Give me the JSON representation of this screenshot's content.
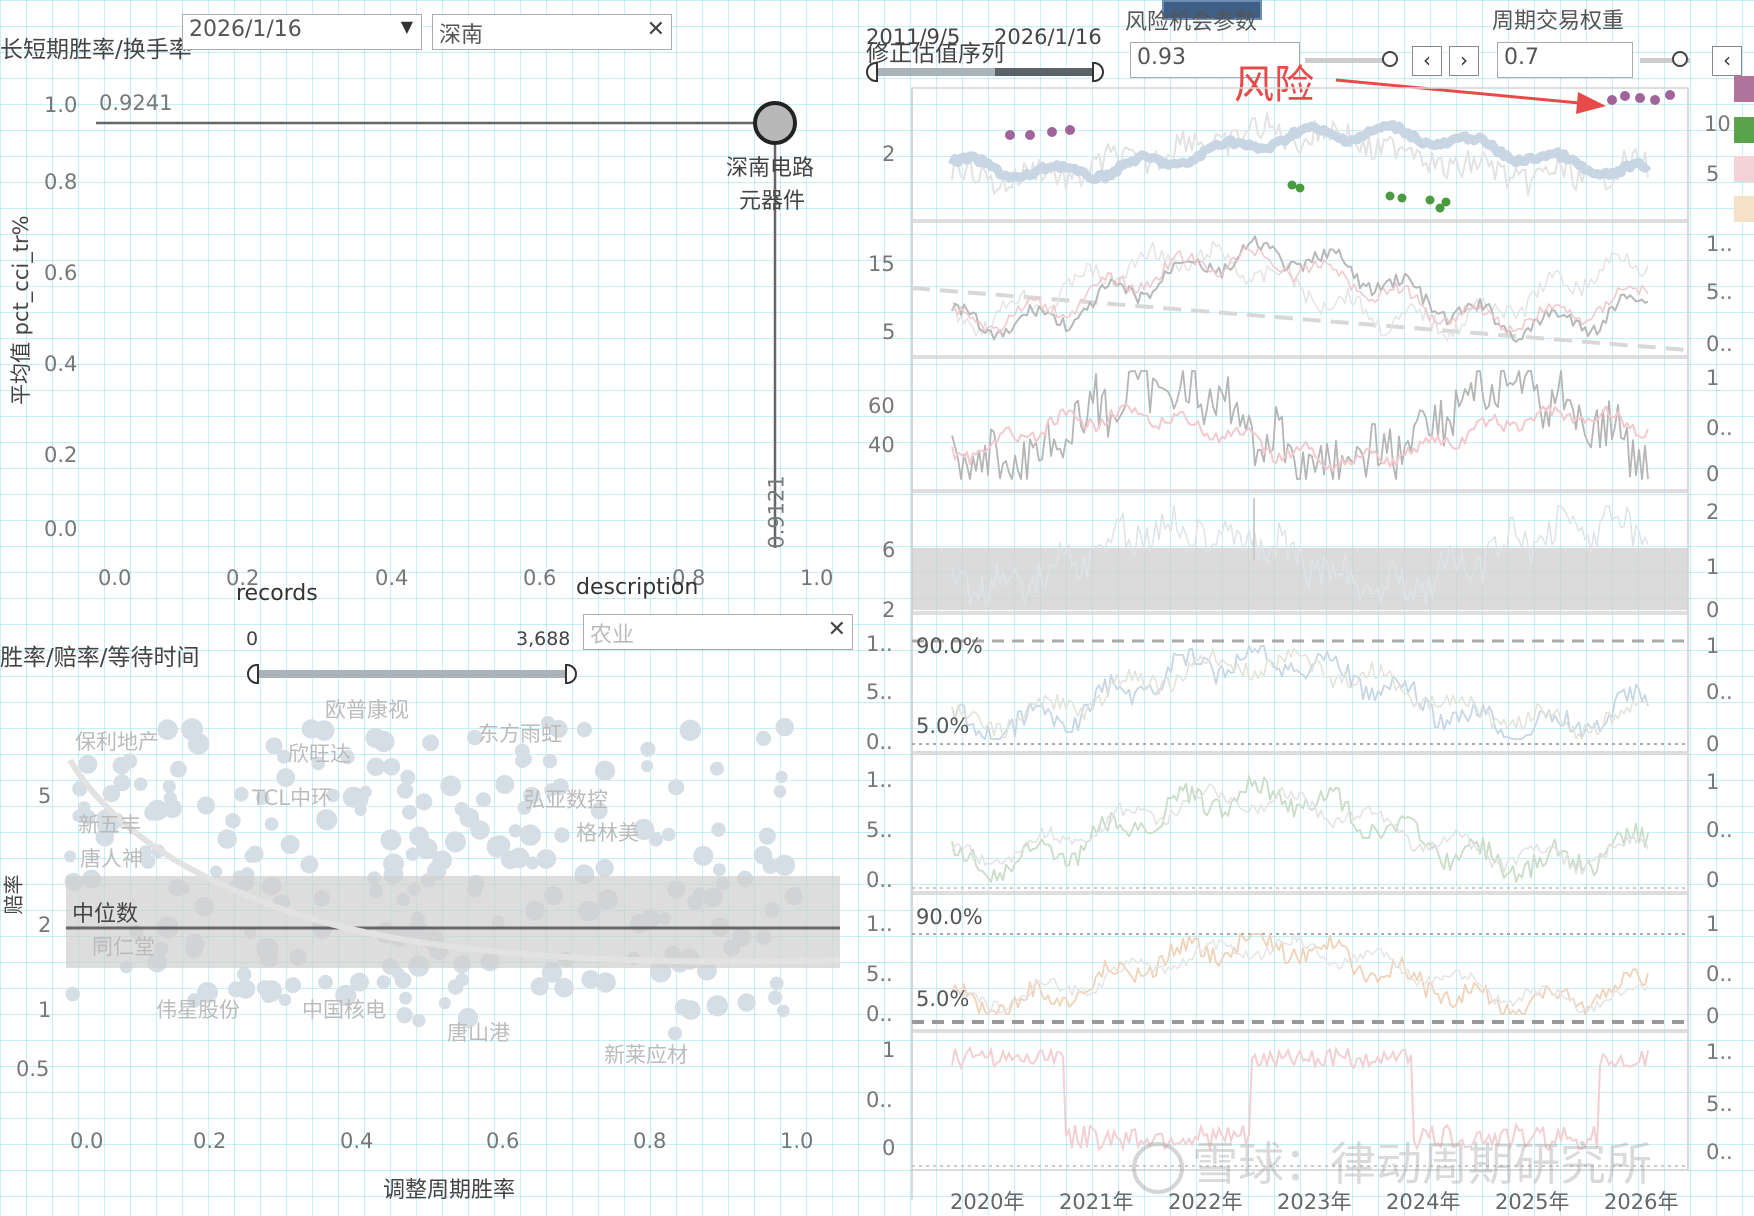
{
  "top_left": {
    "title": "长短期胜率/换手率",
    "date_value": "2026/1/16",
    "search_value": "深南",
    "y_axis_label": "平均值 pct_cci_tr%",
    "y_ticks": [
      "1.0",
      "0.8",
      "0.6",
      "0.4",
      "0.2",
      "0.0"
    ],
    "x_ticks": [
      "0.0",
      "0.2",
      "0.4",
      "0.6",
      "0.8",
      "1.0"
    ],
    "h_ref_label": "0.9241",
    "v_ref_label": "0.9121",
    "point_label_line1": "深南电路",
    "point_label_line2": "元器件",
    "point": {
      "x": 0.9121,
      "y": 0.9241
    }
  },
  "records": {
    "title": "records",
    "min": "0",
    "max": "3,688"
  },
  "description": {
    "title": "description",
    "placeholder": "农业"
  },
  "bottom_left": {
    "title": "胜率/赔率/等待时间",
    "y_axis_label": "赔率",
    "x_axis_label": "调整周期胜率",
    "y_ticks": [
      "5",
      "2",
      "1",
      "0.5"
    ],
    "x_ticks": [
      "0.0",
      "0.2",
      "0.4",
      "0.6",
      "0.8",
      "1.0"
    ],
    "median_label": "中位数",
    "stock_labels": [
      "保利地产",
      "欧普康视",
      "欣旺达",
      "东方雨虹",
      "TCL中环",
      "弘亚数控",
      "新五丰",
      "格林美",
      "唐人神",
      "同仁堂",
      "伟星股份",
      "中国核电",
      "唐山港",
      "新莱应材"
    ]
  },
  "right": {
    "date_range_start": "2011/9/5",
    "date_range_end": "2026/1/16",
    "series_title": "修正估值序列",
    "risk_param_title": "风险机会参数",
    "risk_param_value": "0.93",
    "cycle_weight_title": "周期交易权重",
    "cycle_weight_value": "0.7",
    "annotation": "风险",
    "years": [
      "2020年",
      "2021年",
      "2022年",
      "2023年",
      "2024年",
      "2025年",
      "2026年"
    ],
    "panels": [
      {
        "left_ticks": [
          "2"
        ],
        "right_ticks": [
          "10",
          "5"
        ]
      },
      {
        "left_ticks": [
          "15",
          "5"
        ],
        "right_ticks": [
          "1..",
          "5..",
          "0.."
        ]
      },
      {
        "left_ticks": [
          "60",
          "40"
        ],
        "right_ticks": [
          "1",
          "0..",
          "0"
        ]
      },
      {
        "left_ticks": [
          "6",
          "2"
        ],
        "right_ticks": [
          "2",
          "1",
          "0"
        ]
      },
      {
        "left_ticks": [
          "1..",
          "5..",
          "0.."
        ],
        "right_ticks": [
          "1",
          "0..",
          "0"
        ],
        "ref_top": "90.0%",
        "ref_bottom": "5.0%"
      },
      {
        "left_ticks": [
          "1..",
          "5..",
          "0.."
        ],
        "right_ticks": [
          "1",
          "0..",
          "0"
        ]
      },
      {
        "left_ticks": [
          "1..",
          "5..",
          "0.."
        ],
        "right_ticks": [
          "1",
          "0..",
          "0"
        ],
        "ref_top": "90.0%",
        "ref_bottom": "5.0%"
      },
      {
        "left_ticks": [
          "1",
          "0..",
          "0"
        ],
        "right_ticks": [
          "1..",
          "5..",
          "0.."
        ]
      }
    ],
    "legend_colors": [
      "#b0739c",
      "#5aa34a",
      "#f2d3d7",
      "#f4e1c8"
    ]
  },
  "watermark": "雪球：律动周期研究所",
  "colors": {
    "point_fill": "#b8b8b8",
    "ref_line": "#666666",
    "scatter_dot": "#d5dde5",
    "band": "#d9d9d9",
    "risk_purple": "#a0649a",
    "opportunity_green": "#4a9a3f",
    "annotation_red": "#e84a4a"
  }
}
